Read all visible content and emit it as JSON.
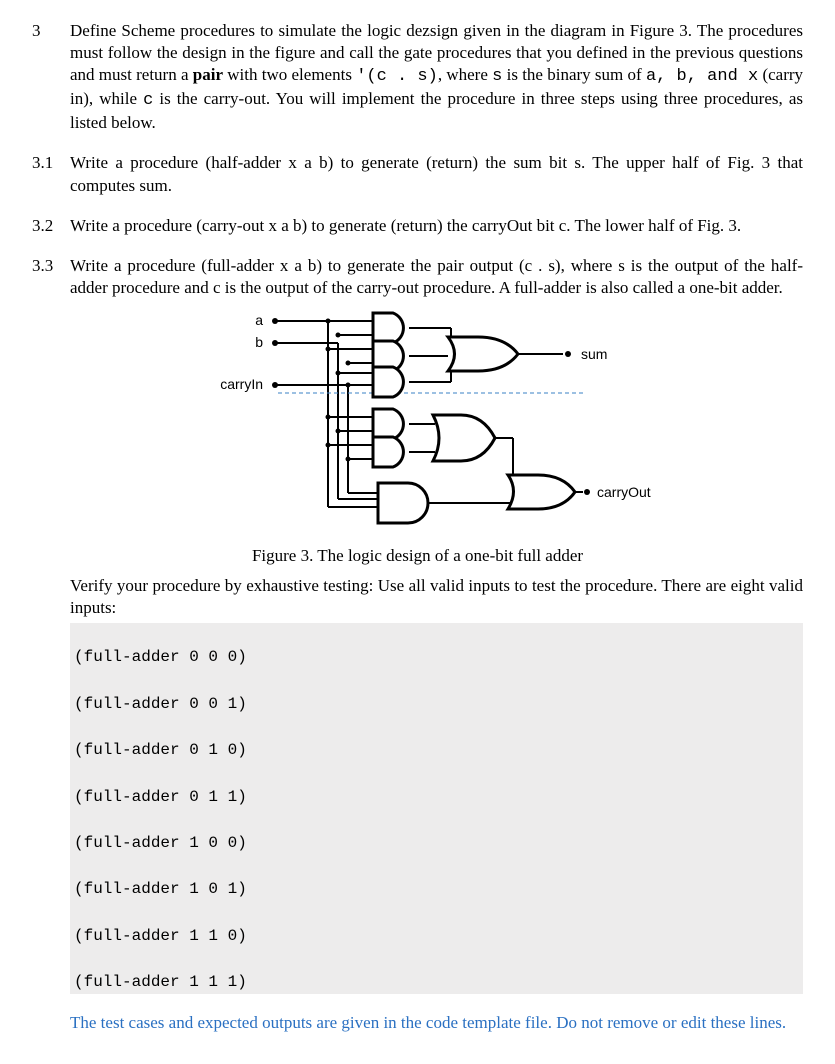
{
  "q3": {
    "num": "3",
    "text_parts": {
      "p1": "Define Scheme procedures to simulate the logic dezsign given in the diagram in Figure 3. The procedures must follow the design in the figure and call the gate procedures that you defined in the previous questions and must return a ",
      "bold1": "pair",
      "p2": " with two elements ",
      "code1": "'(c . s)",
      "p3": ", where ",
      "code2": "s",
      "p4": " is the binary sum of ",
      "code3": "a, b, and x",
      "p5": " (carry in), while ",
      "code4": "c",
      "p6": " is the carry-out. You will implement the procedure in three steps using three procedures, as listed below."
    }
  },
  "q31": {
    "num": "3.1",
    "text": "Write a procedure (half-adder x a b) to generate (return) the sum bit s. The upper half of Fig. 3 that computes sum."
  },
  "q32": {
    "num": "3.2",
    "text": "Write a procedure (carry-out x a b) to generate (return) the carryOut bit c. The lower half of Fig. 3."
  },
  "q33": {
    "num": "3.3",
    "text": "Write a procedure (full-adder x a b) to generate the pair output (c . s), where s is the output of the half-adder procedure and c is the output of the carry-out procedure. A full-adder is also called a one-bit adder."
  },
  "figure": {
    "label_a": "a",
    "label_b": "b",
    "label_carryIn": "carryIn",
    "label_sum": "sum",
    "label_carryOut": "carryOut",
    "caption": "Figure 3. The logic design of a one-bit full adder"
  },
  "verify": {
    "text": "Verify your procedure by exhaustive testing: Use all valid inputs to test the procedure. There are eight valid inputs:"
  },
  "code_lines": [
    "(full-adder 0 0 0)",
    "(full-adder 0 0 1)",
    "(full-adder 0 1 0)",
    "(full-adder 0 1 1)",
    "(full-adder 1 0 0)",
    "(full-adder 1 0 1)",
    "(full-adder 1 1 0)",
    "(full-adder 1 1 1)"
  ],
  "note": {
    "text": "The test cases and expected outputs are given in the code template file. Do not remove or edit these lines."
  }
}
